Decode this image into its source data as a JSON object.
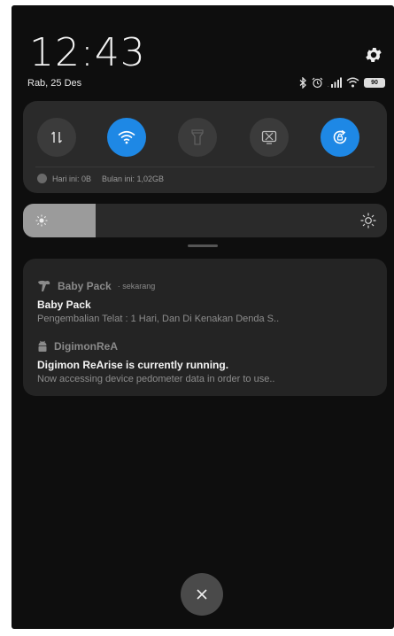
{
  "status_bar": {
    "time": "12:43",
    "date": "Rab, 25 Des",
    "battery": "90",
    "icons": [
      "bluetooth-icon",
      "alarm-icon",
      "signal-icon",
      "wifi-icon",
      "battery-icon"
    ]
  },
  "quick_settings": {
    "toggles": [
      {
        "name": "mobile-data",
        "icon": "data-arrows-icon",
        "on": false
      },
      {
        "name": "wifi",
        "icon": "wifi-icon",
        "on": true
      },
      {
        "name": "flashlight",
        "icon": "flashlight-icon",
        "on": false
      },
      {
        "name": "screenshot",
        "icon": "screenshot-icon",
        "on": false
      },
      {
        "name": "auto-rotate",
        "icon": "rotate-icon",
        "on": true
      }
    ],
    "data_usage": {
      "today": "Hari ini: 0B",
      "month": "Bulan ini: 1,02GB"
    }
  },
  "brightness": {
    "level": 0.2
  },
  "notifications": [
    {
      "app": "Baby Pack",
      "time": "· sekarang",
      "title": "Baby Pack",
      "text": "Pengembalian Telat : 1 Hari,  Dan Di Kenakan Denda S..",
      "icon": "baby-pack-icon"
    },
    {
      "app": "DigimonReA",
      "title": "Digimon ReArise is currently running.",
      "text": "Now accessing device pedometer data in order to use..",
      "icon": "android-icon"
    }
  ],
  "colors": {
    "accent": "#1e88e5",
    "background": "#0e0e0e",
    "panel": "#2a2a2a"
  }
}
